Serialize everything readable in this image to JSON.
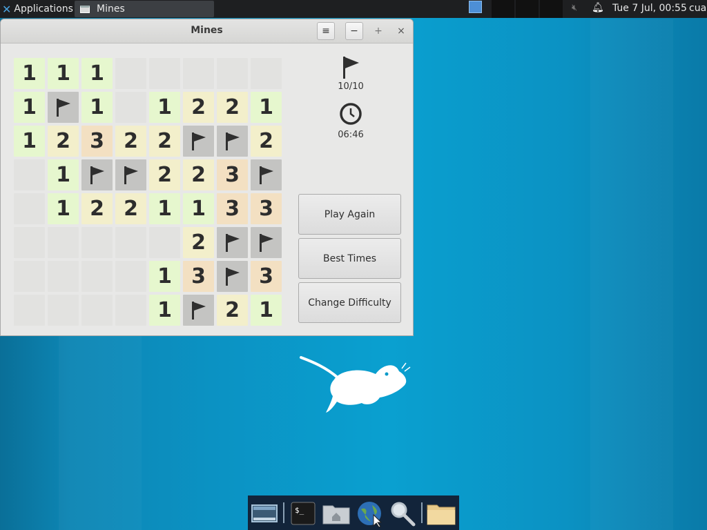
{
  "panel": {
    "applications_label": "Applications",
    "task_label": "Mines",
    "clock": "Tue  7 Jul, 00:55",
    "user": "cua"
  },
  "window": {
    "title": "Mines",
    "menu_glyph": "≡",
    "minimize_glyph": "−",
    "maximize_glyph": "+",
    "close_glyph": "×"
  },
  "game": {
    "flags": "10/10",
    "time": "06:46",
    "grid": [
      [
        "1",
        "1",
        "1",
        "",
        "",
        "",
        "",
        ""
      ],
      [
        "1",
        "F",
        "1",
        "",
        "1",
        "2",
        "2",
        "1"
      ],
      [
        "1",
        "2",
        "3",
        "2",
        "2",
        "F",
        "F",
        "2"
      ],
      [
        "",
        "1",
        "F",
        "F",
        "2",
        "2",
        "3",
        "F"
      ],
      [
        "",
        "1",
        "2",
        "2",
        "1",
        "1",
        "3",
        "3"
      ],
      [
        "",
        "",
        "",
        "",
        "",
        "2",
        "F",
        "F"
      ],
      [
        "",
        "",
        "",
        "",
        "1",
        "3",
        "F",
        "3"
      ],
      [
        "",
        "",
        "",
        "",
        "1",
        "F",
        "2",
        "1"
      ]
    ]
  },
  "buttons": {
    "play_again": "Play Again",
    "best_times": "Best Times",
    "change_difficulty": "Change Difficulty"
  },
  "dock": {
    "items": [
      "show-desktop-icon",
      "terminal-icon",
      "home-folder-icon",
      "web-browser-icon",
      "search-icon",
      "folder-icon"
    ]
  },
  "colors": {
    "number_1": "#e6f7ce",
    "number_2": "#f3efcb",
    "number_3": "#f3e0c2",
    "flagged": "#c4c4c2",
    "unrevealed": "#e2e2e0",
    "desktop": "#0a9ac9"
  }
}
